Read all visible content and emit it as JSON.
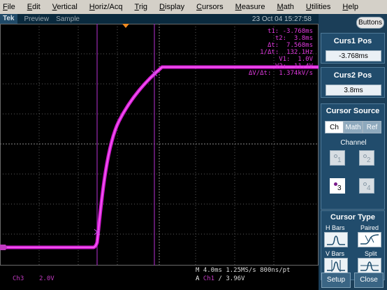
{
  "menu": [
    "File",
    "Edit",
    "Vertical",
    "Horiz/Acq",
    "Trig",
    "Display",
    "Cursors",
    "Measure",
    "Math",
    "Utilities",
    "Help"
  ],
  "status": {
    "brand": "Tek",
    "mode1": "Preview",
    "mode2": "Sample",
    "timestamp": "23 Oct 04 15:27:58"
  },
  "readout": {
    "t1": "t1: -3.768ms",
    "t2": "t2:  3.8ms",
    "dt": "Δt:  7.568ms",
    "inv_dt": "1/Δt:  132.1Hz",
    "v1": "V1:  1.0V",
    "v2": "V2:  11.4V",
    "slope": "ΔV/Δt:  1.374kV/s"
  },
  "bottom": {
    "channel": "Ch3",
    "scale": "2.0V",
    "timebase": "M 4.0ms 1.25MS/s  800ns/pt",
    "trig_a": "A",
    "trig_src": "Ch1",
    "trig_rest": "/  3.96V"
  },
  "panel": {
    "buttons_label": "Buttons",
    "curs1_title": "Curs1 Pos",
    "curs1_value": "-3.768ms",
    "curs2_title": "Curs2 Pos",
    "curs2_value": "3.8ms",
    "source_title": "Cursor Source",
    "tabs": [
      "Ch",
      "Math",
      "Ref"
    ],
    "channel_label": "Channel",
    "channels": [
      "1",
      "2",
      "3",
      "4"
    ],
    "type_title": "Cursor Type",
    "type_labels": [
      "H Bars",
      "Paired",
      "V Bars",
      "Split"
    ],
    "setup_label": "Setup",
    "close_label": "Close"
  },
  "colors": {
    "trace": "#e020e0",
    "cursor": "#a020a0",
    "panel": "#1b3e58"
  }
}
